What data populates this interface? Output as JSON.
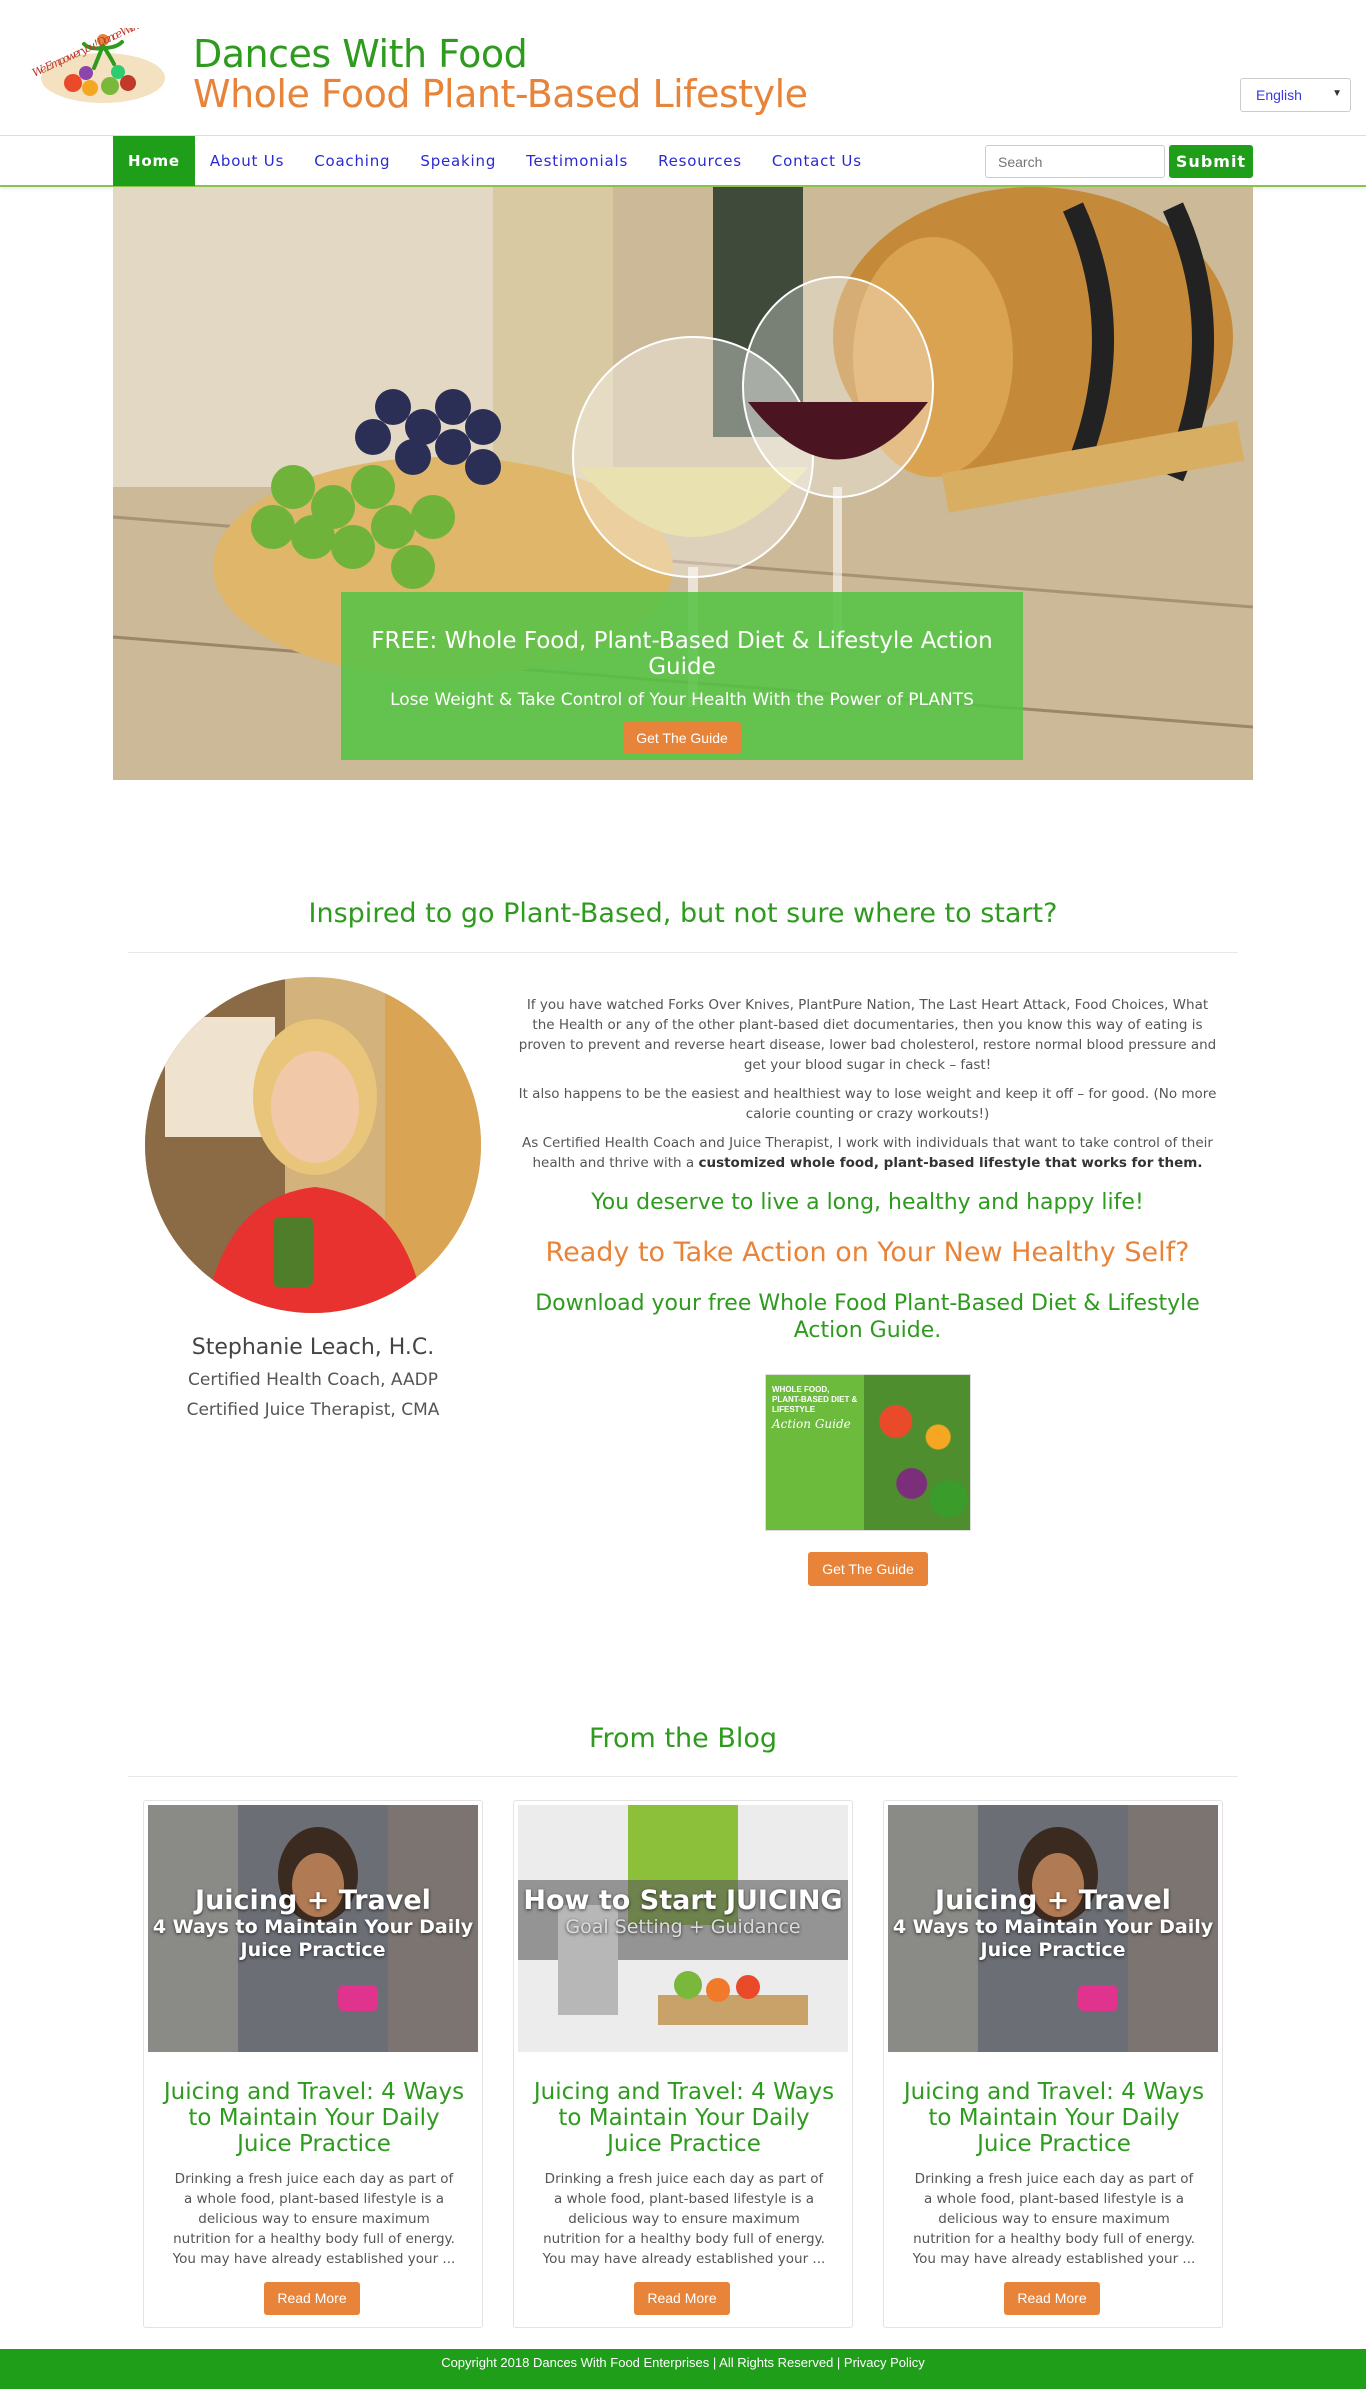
{
  "header": {
    "title": "Dances With Food",
    "tagline": "Whole Food Plant-Based Lifestyle",
    "logo_text": "We Empower you ! Dance With Foods",
    "language": "English"
  },
  "nav": {
    "items": [
      "Home",
      "About Us",
      "Coaching",
      "Speaking",
      "Testimonials",
      "Resources",
      "Contact Us"
    ],
    "search_placeholder": "Search",
    "submit_label": "Submit"
  },
  "hero": {
    "title": "FREE: Whole Food, Plant-Based Diet & Lifestyle Action Guide",
    "subtitle": "Lose Weight & Take Control of Your Health With the Power of PLANTS",
    "button": "Get The Guide"
  },
  "intro": {
    "heading": "Inspired to go Plant-Based, but not sure where to start?",
    "name": "Stephanie Leach, H.C.",
    "cred1": "Certified Health Coach, AADP",
    "cred2": "Certified Juice Therapist, CMA",
    "p1": "If you have watched Forks Over Knives, PlantPure Nation, The Last Heart Attack, Food Choices, What the Health or any of the other plant-based diet documentaries, then you know this way of eating is proven to prevent and reverse heart disease, lower bad cholesterol, restore normal blood pressure and get your blood sugar in check – fast!",
    "p2": "It also happens to be the easiest and healthiest way to lose weight and keep it off – for good. (No more calorie counting or crazy workouts!)",
    "p3_start": "As Certified Health Coach and Juice Therapist, I work with individuals that want to take control of their health and thrive with a ",
    "p3_bold": "customized whole food, plant-based lifestyle that works for them.",
    "deserve": "You deserve to live a long, healthy and happy life!",
    "ready": "Ready to Take Action on Your New Healthy Self?",
    "download": "Download your free Whole Food Plant-Based Diet & Lifestyle Action Guide.",
    "cover_title": "WHOLE FOOD, PLANT-BASED DIET & LIFESTYLE",
    "cover_script": "Action Guide",
    "button": "Get The Guide"
  },
  "blog": {
    "heading": "From the Blog",
    "posts": [
      {
        "img_title": "Juicing + Travel",
        "img_sub": "4 Ways to Maintain Your Daily Juice Practice",
        "title": "Juicing and Travel: 4 Ways to Maintain Your Daily Juice Practice",
        "excerpt": "Drinking a fresh juice each day as part of a whole food, plant-based lifestyle is a delicious way to ensure maximum nutrition for a healthy body full of energy. You may have already established your ...",
        "button": "Read More"
      },
      {
        "img_title": "How to Start JUICING",
        "img_sub": "Goal Setting + Guidance",
        "title": "Juicing and Travel: 4 Ways to Maintain Your Daily Juice Practice",
        "excerpt": "Drinking a fresh juice each day as part of a whole food, plant-based lifestyle is a delicious way to ensure maximum nutrition for a healthy body full of energy. You may have already established your ...",
        "button": "Read More"
      },
      {
        "img_title": "Juicing + Travel",
        "img_sub": "4 Ways to Maintain Your Daily Juice Practice",
        "title": "Juicing and Travel: 4 Ways to Maintain Your Daily Juice Practice",
        "excerpt": "Drinking a fresh juice each day as part of a whole food, plant-based lifestyle is a delicious way to ensure maximum nutrition for a healthy body full of energy. You may have already established your ...",
        "button": "Read More"
      }
    ]
  },
  "footer": {
    "text": "Copyright 2018 Dances With Food Enterprises | All Rights Reserved | Privacy Policy"
  },
  "colors": {
    "brand_green": "#2e9b1e",
    "nav_green": "#1f9e1a",
    "accent_orange": "#e8843a",
    "link_blue": "#2a2ad4"
  }
}
